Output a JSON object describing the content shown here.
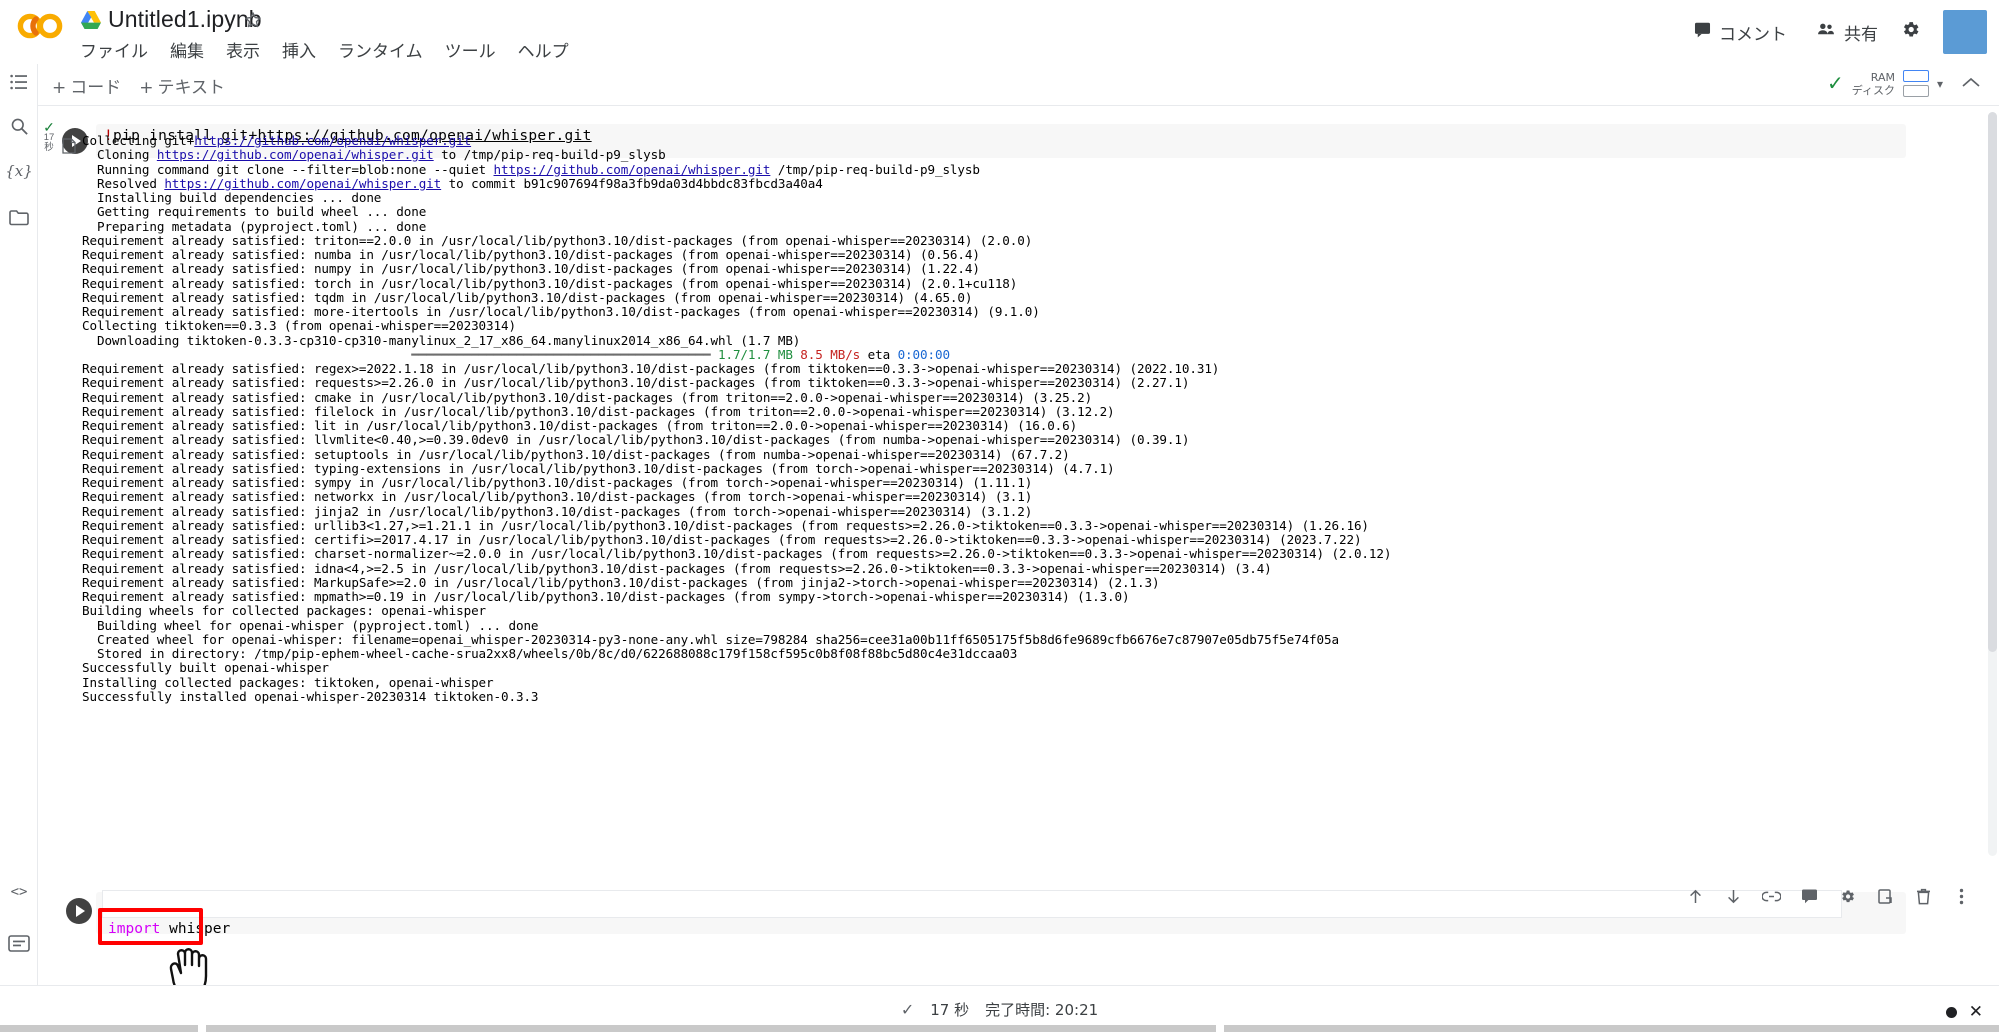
{
  "app": {
    "logo": "colab-logo",
    "doc_title": "Untitled1.ipynb",
    "menu": [
      "ファイル",
      "編集",
      "表示",
      "挿入",
      "ランタイム",
      "ツール",
      "ヘルプ"
    ],
    "comment_label": "コメント",
    "share_label": "共有"
  },
  "toolbar": {
    "add_code": "コード",
    "add_text": "テキスト",
    "plus": "+",
    "ram_label": "RAM",
    "disk_label": "ディスク",
    "caret": "▾",
    "chevron_up": "⌃"
  },
  "rail": {
    "items": [
      {
        "name": "table-of-contents-icon",
        "glyph": "☰"
      },
      {
        "name": "search-icon",
        "glyph": "🔍"
      },
      {
        "name": "variables-icon",
        "glyph": "{x}"
      },
      {
        "name": "files-folder-icon",
        "glyph": "🗀"
      }
    ],
    "bottom_items": [
      {
        "name": "code-snippets-icon",
        "glyph": "<>"
      },
      {
        "name": "command-palette-icon",
        "glyph": "▤"
      },
      {
        "name": "terminal-icon",
        "glyph": ">_"
      }
    ]
  },
  "cells": [
    {
      "id": "cell-1",
      "run_status_check": "✓",
      "run_status_seconds": "17",
      "run_status_unit": "秒",
      "code_bang": "!",
      "code_text": "pip install git+",
      "code_url": "https://github.com/openai/whisper.git",
      "output_lines": [
        "Collecting git+{L:https://github.com/openai/whisper.git}",
        "  Cloning {L:https://github.com/openai/whisper.git} to /tmp/pip-req-build-p9_slysb",
        "  Running command git clone --filter=blob:none --quiet {L:https://github.com/openai/whisper.git} /tmp/pip-req-build-p9_slysb",
        "  Resolved {L:https://github.com/openai/whisper.git} to commit b91c907694f98a3fb9da03d4bbdc83fbcd3a40a4",
        "  Installing build dependencies ... done",
        "  Getting requirements to build wheel ... done",
        "  Preparing metadata (pyproject.toml) ... done",
        "Requirement already satisfied: triton==2.0.0 in /usr/local/lib/python3.10/dist-packages (from openai-whisper==20230314) (2.0.0)",
        "Requirement already satisfied: numba in /usr/local/lib/python3.10/dist-packages (from openai-whisper==20230314) (0.56.4)",
        "Requirement already satisfied: numpy in /usr/local/lib/python3.10/dist-packages (from openai-whisper==20230314) (1.22.4)",
        "Requirement already satisfied: torch in /usr/local/lib/python3.10/dist-packages (from openai-whisper==20230314) (2.0.1+cu118)",
        "Requirement already satisfied: tqdm in /usr/local/lib/python3.10/dist-packages (from openai-whisper==20230314) (4.65.0)",
        "Requirement already satisfied: more-itertools in /usr/local/lib/python3.10/dist-packages (from openai-whisper==20230314) (9.1.0)",
        "Collecting tiktoken==0.3.3 (from openai-whisper==20230314)",
        "  Downloading tiktoken-0.3.3-cp310-cp310-manylinux_2_17_x86_64.manylinux2014_x86_64.whl (1.7 MB)",
        "{BAR}",
        "Requirement already satisfied: regex>=2022.1.18 in /usr/local/lib/python3.10/dist-packages (from tiktoken==0.3.3->openai-whisper==20230314) (2022.10.31)",
        "Requirement already satisfied: requests>=2.26.0 in /usr/local/lib/python3.10/dist-packages (from tiktoken==0.3.3->openai-whisper==20230314) (2.27.1)",
        "Requirement already satisfied: cmake in /usr/local/lib/python3.10/dist-packages (from triton==2.0.0->openai-whisper==20230314) (3.25.2)",
        "Requirement already satisfied: filelock in /usr/local/lib/python3.10/dist-packages (from triton==2.0.0->openai-whisper==20230314) (3.12.2)",
        "Requirement already satisfied: lit in /usr/local/lib/python3.10/dist-packages (from triton==2.0.0->openai-whisper==20230314) (16.0.6)",
        "Requirement already satisfied: llvmlite<0.40,>=0.39.0dev0 in /usr/local/lib/python3.10/dist-packages (from numba->openai-whisper==20230314) (0.39.1)",
        "Requirement already satisfied: setuptools in /usr/local/lib/python3.10/dist-packages (from numba->openai-whisper==20230314) (67.7.2)",
        "Requirement already satisfied: typing-extensions in /usr/local/lib/python3.10/dist-packages (from torch->openai-whisper==20230314) (4.7.1)",
        "Requirement already satisfied: sympy in /usr/local/lib/python3.10/dist-packages (from torch->openai-whisper==20230314) (1.11.1)",
        "Requirement already satisfied: networkx in /usr/local/lib/python3.10/dist-packages (from torch->openai-whisper==20230314) (3.1)",
        "Requirement already satisfied: jinja2 in /usr/local/lib/python3.10/dist-packages (from torch->openai-whisper==20230314) (3.1.2)",
        "Requirement already satisfied: urllib3<1.27,>=1.21.1 in /usr/local/lib/python3.10/dist-packages (from requests>=2.26.0->tiktoken==0.3.3->openai-whisper==20230314) (1.26.16)",
        "Requirement already satisfied: certifi>=2017.4.17 in /usr/local/lib/python3.10/dist-packages (from requests>=2.26.0->tiktoken==0.3.3->openai-whisper==20230314) (2023.7.22)",
        "Requirement already satisfied: charset-normalizer~=2.0.0 in /usr/local/lib/python3.10/dist-packages (from requests>=2.26.0->tiktoken==0.3.3->openai-whisper==20230314) (2.0.12)",
        "Requirement already satisfied: idna<4,>=2.5 in /usr/local/lib/python3.10/dist-packages (from requests>=2.26.0->tiktoken==0.3.3->openai-whisper==20230314) (3.4)",
        "Requirement already satisfied: MarkupSafe>=2.0 in /usr/local/lib/python3.10/dist-packages (from jinja2->torch->openai-whisper==20230314) (2.1.3)",
        "Requirement already satisfied: mpmath>=0.19 in /usr/local/lib/python3.10/dist-packages (from sympy->torch->openai-whisper==20230314) (1.3.0)",
        "Building wheels for collected packages: openai-whisper",
        "  Building wheel for openai-whisper (pyproject.toml) ... done",
        "  Created wheel for openai-whisper: filename=openai_whisper-20230314-py3-none-any.whl size=798284 sha256=cee31a00b11ff6505175f5b8d6fe9689cfb6676e7c87907e05db75f5e74f05a",
        "  Stored in directory: /tmp/pip-ephem-wheel-cache-srua2xx8/wheels/0b/8c/d0/622688088c179f158cf595c0b8f08f88bc5d80c4e31dccaa03",
        "Successfully built openai-whisper",
        "Installing collected packages: tiktoken, openai-whisper",
        "Successfully installed openai-whisper-20230314 tiktoken-0.3.3"
      ],
      "progress_bar": {
        "track": "━━━━━━━━━━━━━━━━━━━━━━━━━━━━━━━━━━━━━━━━",
        "size": "1.7/1.7",
        "unit": "MB",
        "speed": "8.5 MB/s",
        "eta_label": "eta",
        "eta": "0:00:00"
      }
    },
    {
      "id": "cell-2",
      "code_keyword": "import",
      "code_identifier": " whisper",
      "highlighted": true,
      "highlight_color": "#ff0000"
    }
  ],
  "cell_toolbar": {
    "items": [
      {
        "name": "move-cell-up-icon",
        "glyph": "↑"
      },
      {
        "name": "move-cell-down-icon",
        "glyph": "↓"
      },
      {
        "name": "link-to-cell-icon",
        "glyph": "🔗"
      },
      {
        "name": "add-comment-icon",
        "glyph": "▤"
      },
      {
        "name": "cell-settings-icon",
        "glyph": "⚙"
      },
      {
        "name": "copy-cell-icon",
        "glyph": "⧉"
      },
      {
        "name": "delete-cell-icon",
        "glyph": "🗑"
      },
      {
        "name": "more-options-icon",
        "glyph": "⋮"
      }
    ]
  },
  "statusbar": {
    "check": "✓",
    "duration": "17 秒",
    "completed_label": "完了時間: 20:21"
  },
  "colors": {
    "accent_blue": "#1a73e8",
    "link": "#1a0dab",
    "green": "#1e8e3e",
    "red": "#c5221f",
    "highlight_red": "#ff0000",
    "avatar": "#5b9bd5",
    "cell_bg": "#f7f7f7"
  }
}
